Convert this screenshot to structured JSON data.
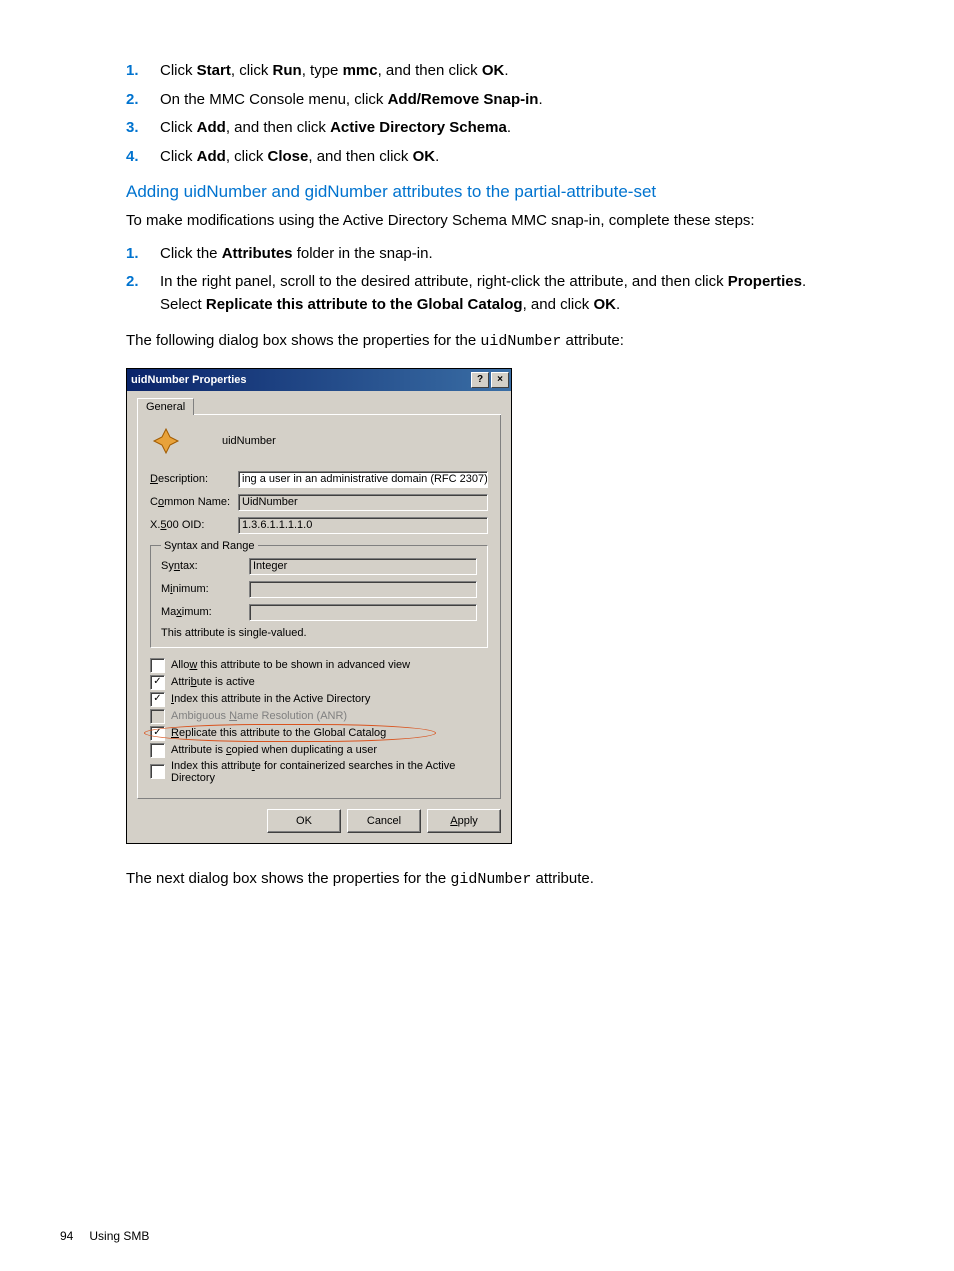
{
  "steps1": [
    {
      "n": "1.",
      "pre": "Click ",
      "b1": "Start",
      "mid1": ", click ",
      "b2": "Run",
      "mid2": ", type ",
      "b3": "mmc",
      "mid3": ", and then click ",
      "b4": "OK",
      "post": "."
    },
    {
      "n": "2.",
      "pre": "On the MMC Console menu, click ",
      "b1": "Add/Remove Snap-in",
      "post": "."
    },
    {
      "n": "3.",
      "pre": "Click ",
      "b1": "Add",
      "mid1": ", and then click ",
      "b2": "Active Directory Schema",
      "post": "."
    },
    {
      "n": "4.",
      "pre": "Click ",
      "b1": "Add",
      "mid1": ", click ",
      "b2": "Close",
      "mid2": ", and then click ",
      "b3": "OK",
      "post": "."
    }
  ],
  "section_title": "Adding uidNumber and gidNumber attributes to the partial-attribute-set",
  "intro": "To make modifications using the Active Directory Schema MMC snap-in, complete these steps:",
  "steps2": [
    {
      "n": "1.",
      "pre": "Click the ",
      "b1": "Attributes",
      "post": " folder in the snap-in."
    },
    {
      "n": "2.",
      "line1_pre": "In the right panel, scroll to the desired attribute, right-click the attribute, and then click ",
      "line1_b": "Properties",
      "line1_post": ".",
      "line2_pre": "Select ",
      "line2_b": "Replicate this attribute to the Global Catalog",
      "line2_mid": ", and click ",
      "line2_b2": "OK",
      "line2_post": "."
    }
  ],
  "para2_pre": "The following dialog box shows the properties for the ",
  "para2_mono": "uidNumber",
  "para2_post": " attribute:",
  "dialog": {
    "title": "uidNumber Properties",
    "tab": "General",
    "name": "uidNumber",
    "fields": {
      "desc_label": "Description:",
      "desc_val": "ing a user in an administrative domain (RFC 2307)",
      "common_label": "Common Name:",
      "common_val": "UidNumber",
      "oid_label": "X.500 OID:",
      "oid_val": "1.3.6.1.1.1.1.0"
    },
    "syntax": {
      "legend": "Syntax and Range",
      "syn_label": "Syntax:",
      "syn_val": "Integer",
      "min_label": "Minimum:",
      "min_val": "",
      "max_label": "Maximum:",
      "max_val": "",
      "note": "This attribute is single-valued."
    },
    "checks": [
      {
        "checked": false,
        "disabled": false,
        "label": "Allow this attribute to be shown in advanced view",
        "u": "w",
        "pre": "Allo",
        "post": " this attribute to be shown in advanced view"
      },
      {
        "checked": true,
        "disabled": false,
        "label": "Attribute is active",
        "u": "b",
        "pre": "Attri",
        "post": "ute is active"
      },
      {
        "checked": true,
        "disabled": false,
        "label": "Index this attribute in the Active Directory",
        "u": "I",
        "pre": "",
        "post": "ndex this attribute in the Active Directory"
      },
      {
        "checked": false,
        "disabled": true,
        "label": "Ambiguous Name Resolution (ANR)",
        "u": "N",
        "pre": "Ambiguous ",
        "post": "ame Resolution (ANR)"
      },
      {
        "checked": true,
        "disabled": false,
        "label": "Replicate this attribute to the Global Catalog",
        "u": "R",
        "pre": "",
        "post": "eplicate this attribute to the Global Catalog"
      },
      {
        "checked": false,
        "disabled": false,
        "label": "Attribute is copied when duplicating a user",
        "u": "c",
        "pre": "Attribute is ",
        "post": "opied when duplicating a user"
      },
      {
        "checked": false,
        "disabled": false,
        "label": "Index this attribute for containerized searches in the Active Directory",
        "u": "t",
        "pre": "Index this attribu",
        "post": "e for containerized searches in the Active Directory"
      }
    ],
    "buttons": {
      "ok": "OK",
      "cancel": "Cancel",
      "apply": "Apply"
    }
  },
  "para3_pre": "The next dialog box shows the properties for the ",
  "para3_mono": "gidNumber",
  "para3_post": " attribute.",
  "footer": {
    "page": "94",
    "section": "Using SMB"
  }
}
